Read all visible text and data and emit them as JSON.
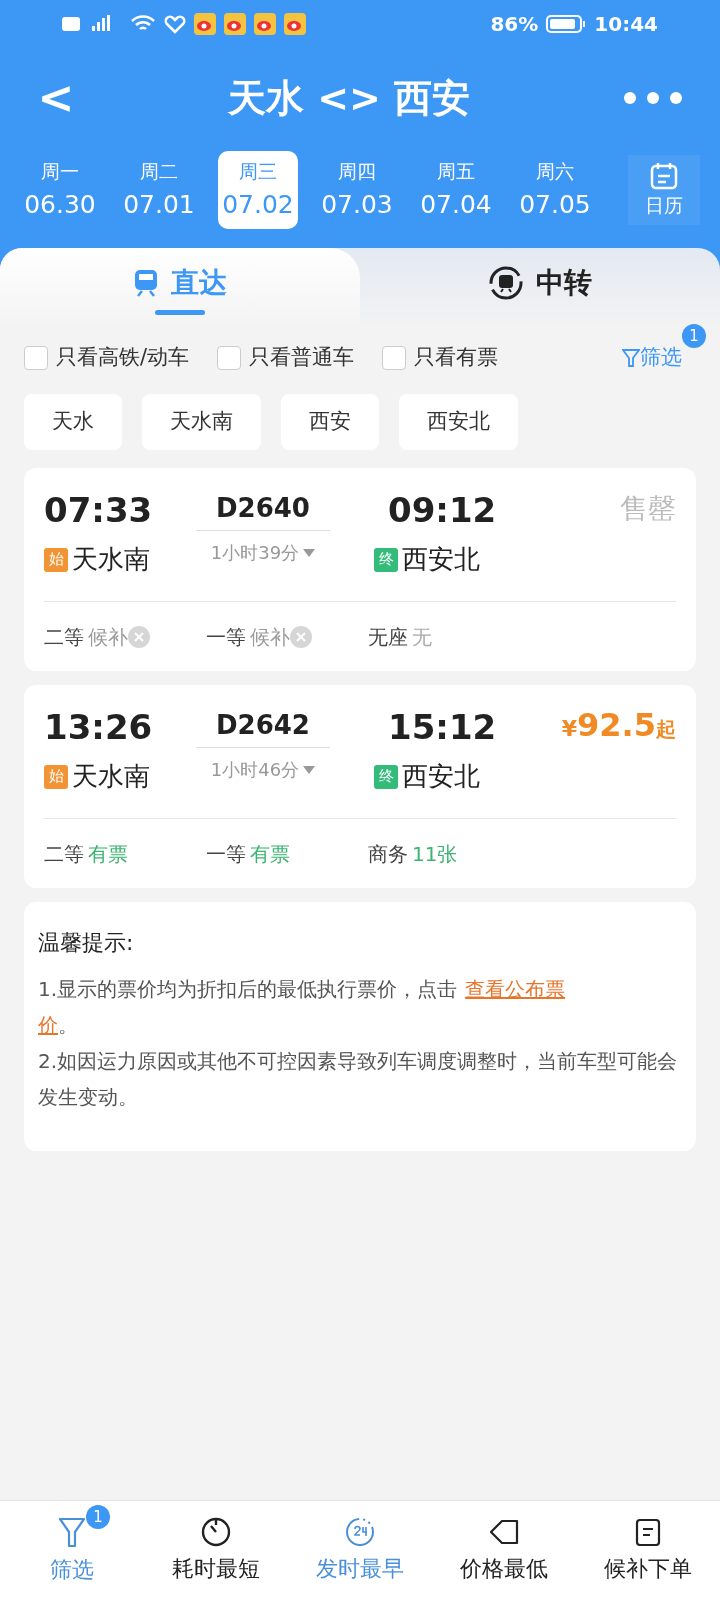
{
  "status_bar": {
    "battery": "86%",
    "time": "10:44"
  },
  "header": {
    "title": "天水 <> 西安",
    "back": "<"
  },
  "dates": [
    {
      "weekday": "周一",
      "date": "06.30",
      "selected": false
    },
    {
      "weekday": "周二",
      "date": "07.01",
      "selected": false
    },
    {
      "weekday": "周三",
      "date": "07.02",
      "selected": true
    },
    {
      "weekday": "周四",
      "date": "07.03",
      "selected": false
    },
    {
      "weekday": "周五",
      "date": "07.04",
      "selected": false
    },
    {
      "weekday": "周六",
      "date": "07.05",
      "selected": false
    }
  ],
  "calendar_button": "日历",
  "tabs": [
    {
      "label": "直达",
      "selected": true
    },
    {
      "label": "中转",
      "selected": false
    }
  ],
  "quick_filters": [
    {
      "label": "只看高铁/动车",
      "checked": false
    },
    {
      "label": "只看普通车",
      "checked": false
    },
    {
      "label": "只看有票",
      "checked": false
    }
  ],
  "filter_button": {
    "label": "筛选",
    "badge": "1"
  },
  "stations": [
    "天水",
    "天水南",
    "西安",
    "西安北"
  ],
  "trains": [
    {
      "depart": "07:33",
      "number": "D2640",
      "arrive": "09:12",
      "from_tag": "始",
      "from": "天水南",
      "duration": "1小时39分",
      "to_tag": "终",
      "to": "西安北",
      "sold_out": true,
      "status": "售罄",
      "seats": [
        {
          "class": "二等",
          "status": "候补",
          "kind": "waitlist"
        },
        {
          "class": "一等",
          "status": "候补",
          "kind": "waitlist"
        },
        {
          "class": "无座",
          "status": "无",
          "kind": "none"
        }
      ]
    },
    {
      "depart": "13:26",
      "number": "D2642",
      "arrive": "15:12",
      "from_tag": "始",
      "from": "天水南",
      "duration": "1小时46分",
      "to_tag": "终",
      "to": "西安北",
      "sold_out": false,
      "price": "¥92.5",
      "price_suffix": "起",
      "seats": [
        {
          "class": "二等",
          "status": "有票",
          "kind": "available"
        },
        {
          "class": "一等",
          "status": "有票",
          "kind": "available"
        },
        {
          "class": "商务",
          "status": "11张",
          "kind": "available"
        }
      ]
    }
  ],
  "tips": {
    "title": "温馨提示:",
    "line1": "1.显示的票价均为折扣后的最低执行票价，点击",
    "link_part1": "查看公布票",
    "link_part2": "价",
    "line1_end": "。",
    "line2": "2.如因运力原因或其他不可控因素导致列车调度调整时，当前车型可能会发生变动。"
  },
  "bottom_nav": [
    {
      "label": "筛选",
      "kind": "filter",
      "selected": true,
      "badge": "1"
    },
    {
      "label": "耗时最短",
      "kind": "timer",
      "selected": false
    },
    {
      "label": "发时最早",
      "kind": "clock24",
      "selected": true
    },
    {
      "label": "价格最低",
      "kind": "tag",
      "selected": false
    },
    {
      "label": "候补下单",
      "kind": "waitlist",
      "selected": false
    }
  ]
}
